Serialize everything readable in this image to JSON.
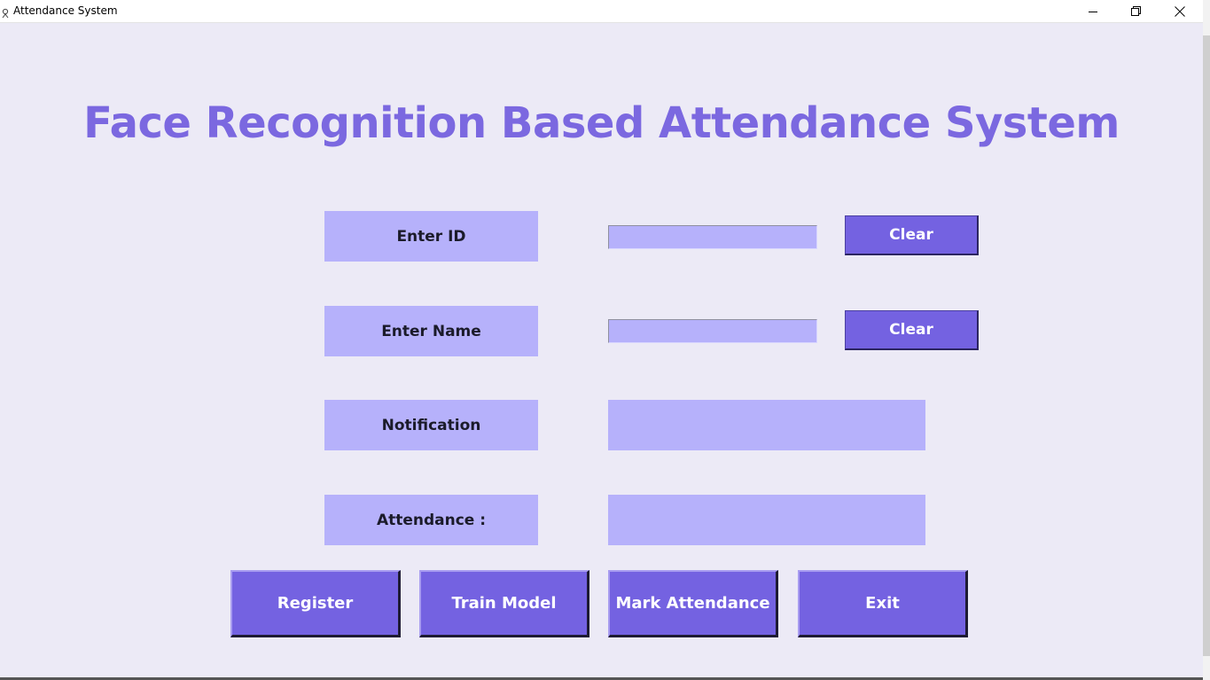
{
  "window": {
    "title": "Attendance System",
    "icon": "feather-icon",
    "controls": {
      "minimize": "minimize-icon",
      "restore": "restore-icon",
      "close": "close-icon"
    }
  },
  "heading": "Face Recognition Based Attendance System",
  "form": {
    "id_label": "Enter ID",
    "id_value": "",
    "id_clear": "Clear",
    "name_label": "Enter Name",
    "name_value": "",
    "name_clear": "Clear",
    "notification_label": "Notification",
    "notification_value": "",
    "attendance_label": "Attendance :",
    "attendance_value": ""
  },
  "actions": {
    "register": "Register",
    "train": "Train Model",
    "mark": "Mark Attendance",
    "exit": "Exit"
  },
  "colors": {
    "background": "#eceaf6",
    "heading": "#7b68e0",
    "field": "#b6b1fb",
    "button": "#7462e1",
    "button_text": "#ffffff"
  }
}
